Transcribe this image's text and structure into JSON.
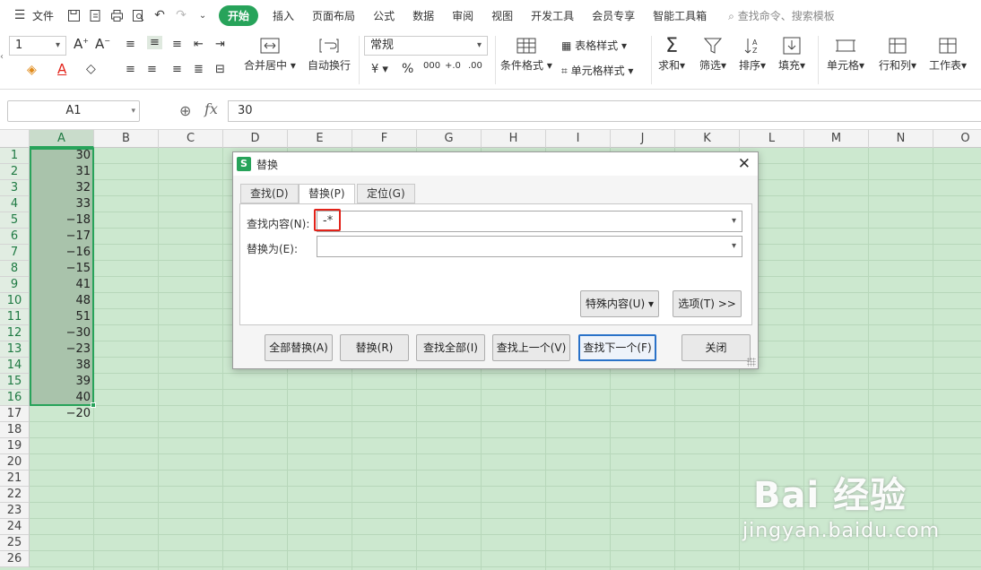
{
  "menubar": {
    "file_label": "文件",
    "tabs": [
      "开始",
      "插入",
      "页面布局",
      "公式",
      "数据",
      "审阅",
      "视图",
      "开发工具",
      "会员专享",
      "智能工具箱"
    ],
    "active_tab": "开始",
    "search_placeholder": "查找命令、搜索模板",
    "accent_color": "#27a35a"
  },
  "ribbon": {
    "font_size": "1",
    "number_format": "常规",
    "merge_label": "合并居中",
    "wrap_label": "自动换行",
    "table_style_label": "表格样式",
    "cell_style_label": "单元格样式",
    "cond_format_label": "条件格式",
    "sum_label": "求和",
    "filter_label": "筛选",
    "sort_label": "排序",
    "fill_label": "填充",
    "cell_label": "单元格",
    "rowcol_label": "行和列",
    "sheet_label": "工作表",
    "currency_symbol": "¥",
    "percent_symbol": "%"
  },
  "formula_bar": {
    "name_box": "A1",
    "fx_label": "fx",
    "value": "30"
  },
  "sheet": {
    "columns": [
      "A",
      "B",
      "C",
      "D",
      "E",
      "F",
      "G",
      "H",
      "I",
      "J",
      "K",
      "L",
      "M",
      "N",
      "O"
    ],
    "rows": [
      "1",
      "2",
      "3",
      "4",
      "5",
      "6",
      "7",
      "8",
      "9",
      "10",
      "11",
      "12",
      "13",
      "14",
      "15",
      "16",
      "17",
      "18",
      "19",
      "20",
      "21",
      "22",
      "23",
      "24",
      "25",
      "26"
    ],
    "column_a_values": [
      "30",
      "31",
      "32",
      "33",
      "−18",
      "−17",
      "−16",
      "−15",
      "41",
      "48",
      "51",
      "−30",
      "−23",
      "38",
      "39",
      "40",
      "−20"
    ],
    "grid_color": "#cce8cf",
    "selection_color": "#27a35a"
  },
  "dialog": {
    "title": "替换",
    "logo_letter": "S",
    "tabs": [
      "查找(D)",
      "替换(P)",
      "定位(G)"
    ],
    "active_tab": "替换(P)",
    "find_label": "查找内容(N):",
    "find_value": "-*",
    "replace_label": "替换为(E):",
    "replace_value": "",
    "special_button": "特殊内容(U)",
    "options_button": "选项(T) >>",
    "buttons": {
      "replace_all": "全部替换(A)",
      "replace": "替换(R)",
      "find_all": "查找全部(I)",
      "find_prev": "查找上一个(V)",
      "find_next": "查找下一个(F)",
      "close": "关闭"
    }
  },
  "watermark": {
    "logo": "Bai  经验",
    "url": "jingyan.baidu.com"
  },
  "annotation_color": "#e2231a"
}
